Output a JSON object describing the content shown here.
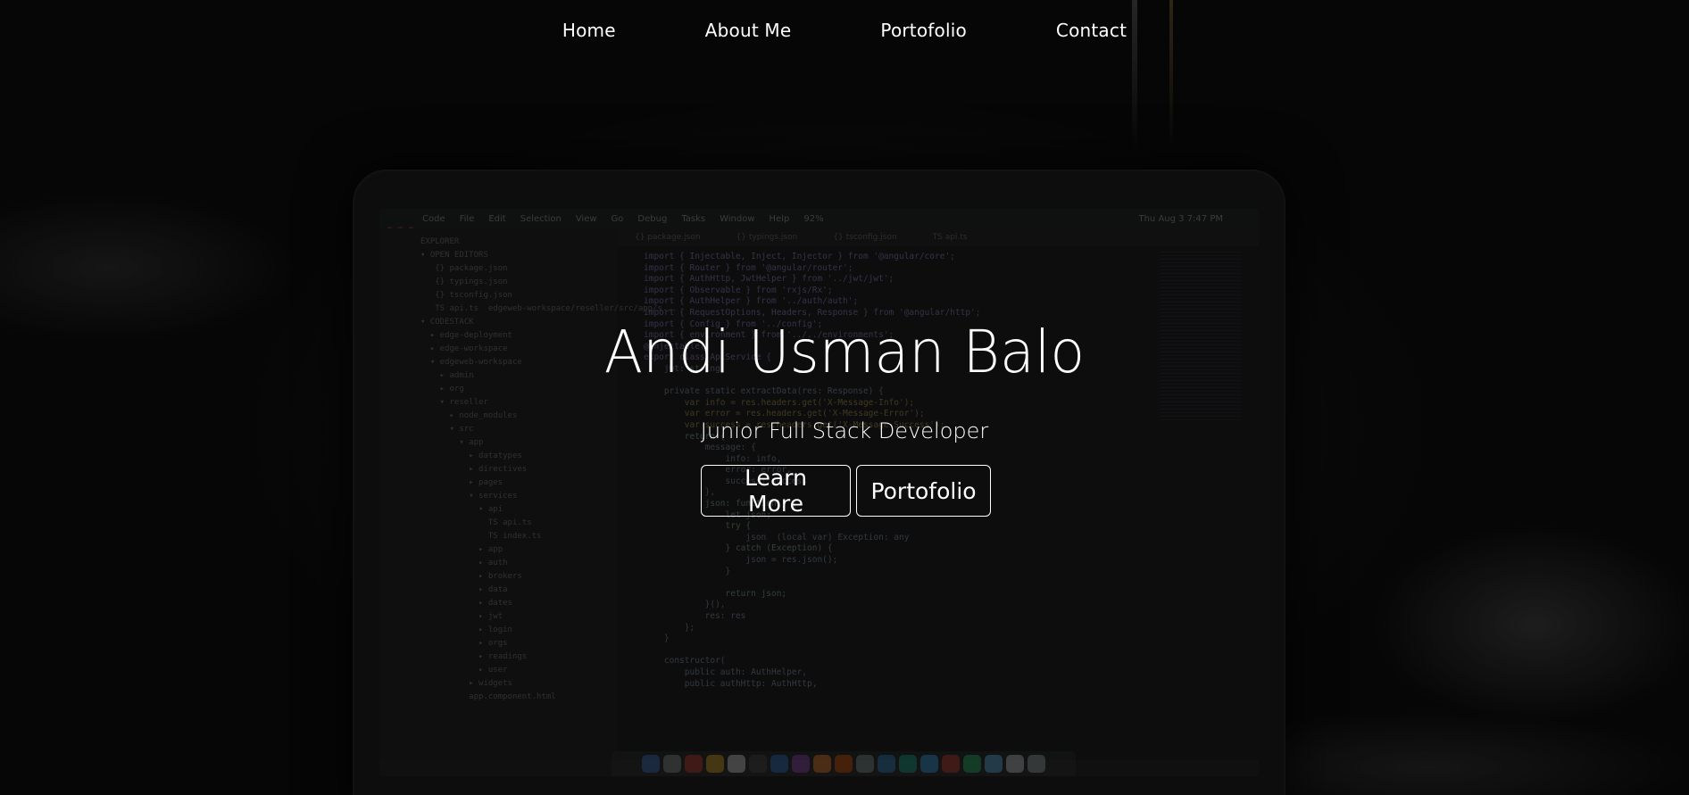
{
  "nav": {
    "items": [
      {
        "label": "Home"
      },
      {
        "label": "About Me"
      },
      {
        "label": "Portofolio"
      },
      {
        "label": "Contact"
      }
    ]
  },
  "hero": {
    "title": "Andi Usman Balo",
    "subtitle": "Junior Full Stack Developer",
    "buttons": {
      "learn_more": "Learn More",
      "portfolio": "Portofolio"
    }
  },
  "background": {
    "description_icon": "laptop-code-editor-icon",
    "menubar": {
      "items": [
        "Code",
        "File",
        "Edit",
        "Selection",
        "View",
        "Go",
        "Debug",
        "Tasks",
        "Window",
        "Help"
      ],
      "clock": "Thu Aug 3  7:47 PM",
      "battery": "92%"
    },
    "explorer_text": "EXPLORER\n▾ OPEN EDITORS\n   {} package.json\n   {} typings.json\n   {} tsconfig.json\n   TS api.ts  edgeweb-workspace/reseller/src/app/s...\n▾ CODESTACK\n  ▸ edge-deployment\n  ▸ edge-workspace\n  ▾ edgeweb-workspace\n    ▸ admin\n    ▸ org\n    ▾ reseller\n      ▸ node_modules\n      ▾ src\n        ▾ app\n          ▸ datatypes\n          ▸ directives\n          ▸ pages\n          ▾ services\n            ▾ api\n              TS api.ts\n              TS index.ts\n            ▸ app\n            ▸ auth\n            ▸ brokers\n            ▸ data\n            ▸ dates\n            ▸ jwt\n            ▸ login\n            ▸ orgs\n            ▸ readings\n            ▸ user\n          ▸ widgets\n          app.component.html",
    "tabs": [
      "{} package.json",
      "{} typings.json",
      "{} tsconfig.json",
      "TS api.ts"
    ],
    "code_lines": [
      "import { Injectable, Inject, Injector } from '@angular/core';",
      "import { Router } from '@angular/router';",
      "import { AuthHttp, JwtHelper } from '../jwt/jwt';",
      "import { Observable } from 'rxjs/Rx';",
      "import { AuthHelper } from '../auth/auth';",
      "import { RequestOptions, Headers, Response } from '@angular/http';",
      "import { Config } from '../config';",
      "import { environment } from '../../environments';",
      "@Injectable()",
      "export class ApiService {",
      "    jwt: string;",
      "",
      "    private static extractData(res: Response) {",
      "        var info = res.headers.get('X-Message-Info');",
      "        var error = res.headers.get('X-Message-Error');",
      "        var success = res.headers.get('X-Message-Success');",
      "        return {",
      "            message: {",
      "                info: info,",
      "                error: error,",
      "                success: success",
      "            },",
      "            json: function() {",
      "                let json;",
      "                try {",
      "                    json  (local var) Exception: any",
      "                } catch (Exception) {",
      "                    json = res.json();",
      "                }",
      "",
      "                return json;",
      "            }(),",
      "            res: res",
      "        };",
      "    }",
      "",
      "    constructor(",
      "        public auth: AuthHelper,",
      "        public authHttp: AuthHttp,"
    ],
    "colors": {
      "page_background": "#0b0b0b",
      "text": "#ffffff",
      "button_border": "#ffffff"
    }
  }
}
